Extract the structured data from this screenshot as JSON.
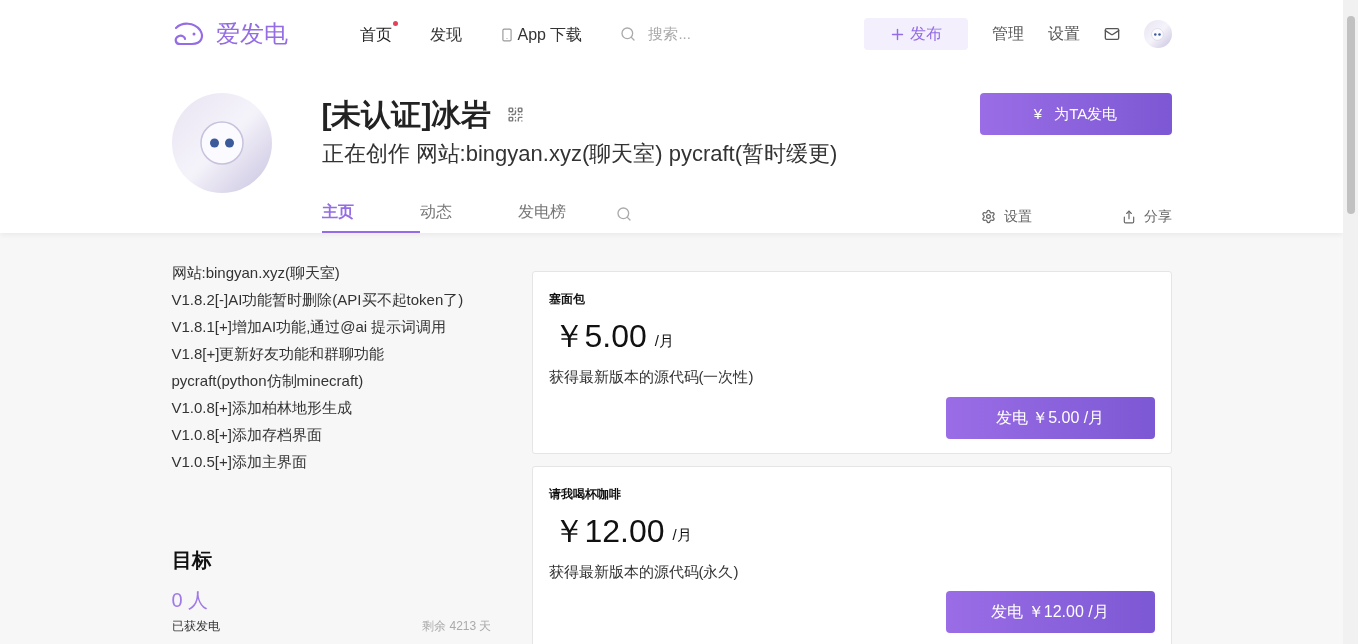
{
  "nav": {
    "logo": "爱发电",
    "links": [
      {
        "label": "首页",
        "selected": true,
        "dot": true
      },
      {
        "label": "发现",
        "selected": false,
        "dot": false
      },
      {
        "label": "App 下载",
        "selected": false,
        "dot": false,
        "kind": "phone"
      }
    ],
    "search": {
      "placeholder": "搜索..."
    },
    "publish": "发布",
    "actions": [
      "管理",
      "设置"
    ]
  },
  "profile": {
    "name": "[未认证]冰岩",
    "bio": "正在创作 网站:bingyan.xyz(聊天室) pycraft(暂时缓更)",
    "support_button": "为TA发电",
    "support_icon": "¥",
    "tabs": [
      {
        "label": "主页",
        "selected": true
      },
      {
        "label": "动态",
        "selected": false
      },
      {
        "label": "发电榜",
        "selected": false
      }
    ],
    "settings": "设置",
    "share": "分享"
  },
  "about": [
    "网站:bingyan.xyz(聊天室)",
    "V1.8.2[-]AI功能暂时删除(API买不起token了)",
    "V1.8.1[+]增加AI功能,通过@ai 提示词调用",
    "V1.8[+]更新好友功能和群聊功能",
    "pycraft(python仿制minecraft)",
    "V1.0.8[+]添加柏林地形生成",
    "V1.0.8[+]添加存档界面",
    "V1.0.5[+]添加主界面"
  ],
  "goal": {
    "title": "目标",
    "count": "0 人",
    "label": "已获发电",
    "remaining": "剩余 4213 天"
  },
  "plans": [
    {
      "name": "塞面包",
      "price": "￥5.00",
      "unit": "/月",
      "desc": "获得最新版本的源代码(一次性)",
      "button": "发电 ￥5.00 /月"
    },
    {
      "name": "请我喝杯咖啡",
      "price": "￥12.00",
      "unit": "/月",
      "desc": "获得最新版本的源代码(永久)",
      "button": "发电 ￥12.00 /月"
    }
  ]
}
